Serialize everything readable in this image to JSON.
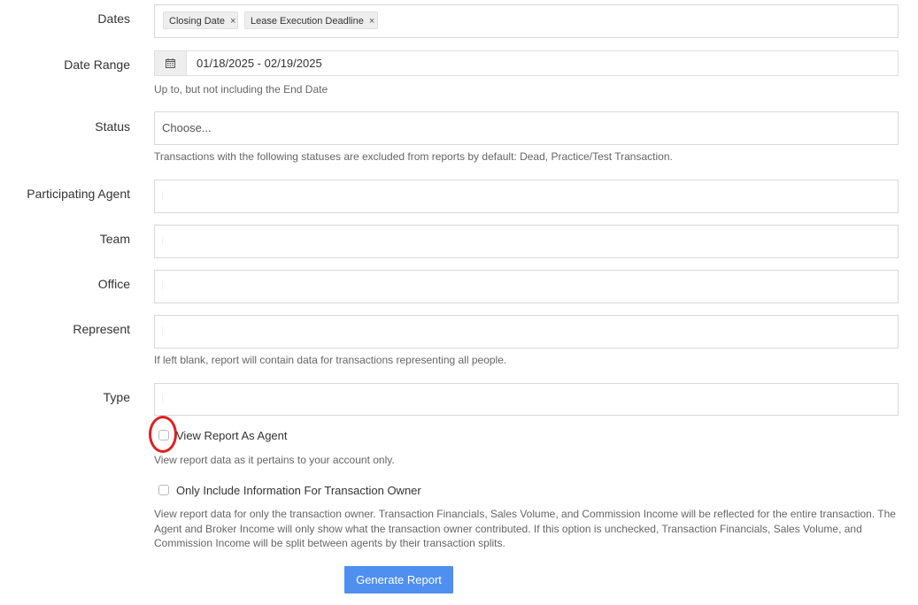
{
  "form": {
    "dates": {
      "label": "Dates",
      "tags": [
        {
          "text": "Closing Date",
          "remove": "×"
        },
        {
          "text": "Lease Execution Deadline",
          "remove": "×"
        }
      ]
    },
    "date_range": {
      "label": "Date Range",
      "value": "01/18/2025 - 02/19/2025",
      "hint": "Up to, but not including the End Date",
      "icon": "calendar-icon"
    },
    "status": {
      "label": "Status",
      "placeholder": "Choose...",
      "hint": "Transactions with the following statuses are excluded from reports by default: Dead, Practice/Test Transaction."
    },
    "participating_agent": {
      "label": "Participating Agent"
    },
    "team": {
      "label": "Team"
    },
    "office": {
      "label": "Office"
    },
    "represent": {
      "label": "Represent",
      "hint": "If left blank, report will contain data for transactions representing all people."
    },
    "type": {
      "label": "Type"
    },
    "view_as_agent": {
      "label": "View Report As Agent",
      "hint": "View report data as it pertains to your account only.",
      "checked": false
    },
    "owner_only": {
      "label": "Only Include Information For Transaction Owner",
      "hint": "View report data for only the transaction owner. Transaction Financials, Sales Volume, and Commission Income will be reflected for the entire transaction. The Agent and Broker Income will only show what the transaction owner contributed. If this option is unchecked, Transaction Financials, Sales Volume, and Commission Income will be split between agents by their transaction splits.",
      "checked": false
    },
    "submit_label": "Generate Report"
  },
  "colors": {
    "accent": "#4f8ff0",
    "highlight": "#e02020",
    "border": "#d9d9d9"
  }
}
